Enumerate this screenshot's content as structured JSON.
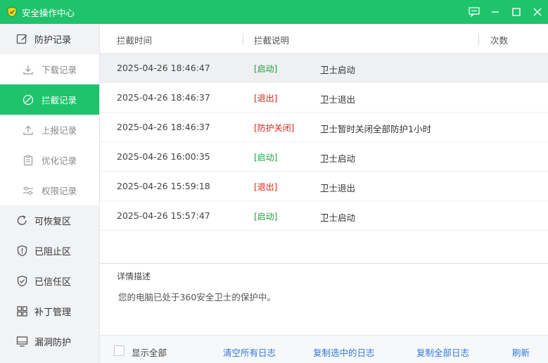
{
  "window": {
    "title": "安全操作中心",
    "logo_icon": "shield-logo-icon",
    "controls": [
      "feedback-icon",
      "minimize-icon",
      "maximize-icon",
      "close-icon"
    ]
  },
  "colors": {
    "accent": "#1fc36b",
    "tag_green": "#1a9e3f",
    "tag_red": "#e0211a",
    "link": "#2f78d6"
  },
  "sidebar": {
    "top": {
      "label": "防护记录",
      "icon": "edit-icon"
    },
    "sub_items": [
      {
        "label": "下载记录",
        "icon": "download-icon"
      },
      {
        "label": "拦截记录",
        "icon": "block-icon",
        "active": true
      },
      {
        "label": "上报记录",
        "icon": "upload-icon"
      },
      {
        "label": "优化记录",
        "icon": "clipboard-icon"
      },
      {
        "label": "权限记录",
        "icon": "sliders-icon"
      }
    ],
    "items": [
      {
        "label": "可恢复区",
        "icon": "restore-icon"
      },
      {
        "label": "已阻止区",
        "icon": "shield-alert-icon"
      },
      {
        "label": "已信任区",
        "icon": "shield-check-icon"
      },
      {
        "label": "补丁管理",
        "icon": "grid-icon"
      },
      {
        "label": "漏洞防护",
        "icon": "monitor-icon"
      }
    ]
  },
  "table": {
    "headers": {
      "time": "拦截时间",
      "desc": "拦截说明",
      "count": "次数"
    },
    "rows": [
      {
        "time": "2025-04-26 18:46:47",
        "tag": "[启动]",
        "tag_type": "green",
        "desc": "卫士启动"
      },
      {
        "time": "2025-04-26 18:46:37",
        "tag": "[退出]",
        "tag_type": "red",
        "desc": "卫士退出"
      },
      {
        "time": "2025-04-26 18:46:37",
        "tag": "[防护关闭]",
        "tag_type": "red",
        "desc": "卫士暂时关闭全部防护1小时"
      },
      {
        "time": "2025-04-26 16:00:35",
        "tag": "[启动]",
        "tag_type": "green",
        "desc": "卫士启动"
      },
      {
        "time": "2025-04-26 15:59:18",
        "tag": "[退出]",
        "tag_type": "red",
        "desc": "卫士退出"
      },
      {
        "time": "2025-04-26 15:57:47",
        "tag": "[启动]",
        "tag_type": "green",
        "desc": "卫士启动"
      }
    ]
  },
  "detail": {
    "title": "详情描述",
    "text": "您的电脑已处于360安全卫士的保护中。"
  },
  "footer": {
    "show_all_label": "显示全部",
    "clear_all": "清空所有日志",
    "copy_selected": "复制选中的日志",
    "copy_all": "复制全部日志",
    "refresh": "刷新"
  }
}
